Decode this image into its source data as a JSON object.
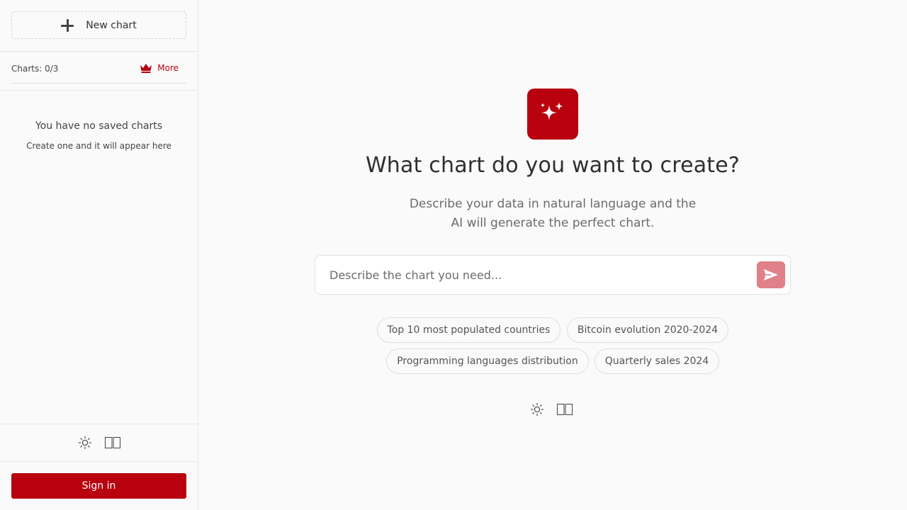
{
  "sidebar": {
    "new_chart_label": "New chart",
    "charts_count": "Charts: 0/3",
    "more_label": "More",
    "empty_title": "You have no saved charts",
    "empty_subtitle": "Create one and it will appear here",
    "sign_in_label": "Sign in"
  },
  "main": {
    "headline": "What chart do you want to create?",
    "subline_1": "Describe your data in natural language and the",
    "subline_2": "AI will generate the perfect chart.",
    "prompt_placeholder": "Describe the chart you need...",
    "suggestions": [
      "Top 10 most populated countries",
      "Bitcoin evolution 2020-2024",
      "Programming languages distribution",
      "Quarterly sales 2024"
    ]
  },
  "icons": {
    "new_chart": "plus-icon",
    "more": "crown-icon",
    "logo": "sparkles-icon",
    "send": "send-icon",
    "theme": "sun-icon",
    "language": "language-flag-icon"
  },
  "colors": {
    "accent": "#b8000f",
    "send_button": "#e08088",
    "background": "#fafafa"
  }
}
